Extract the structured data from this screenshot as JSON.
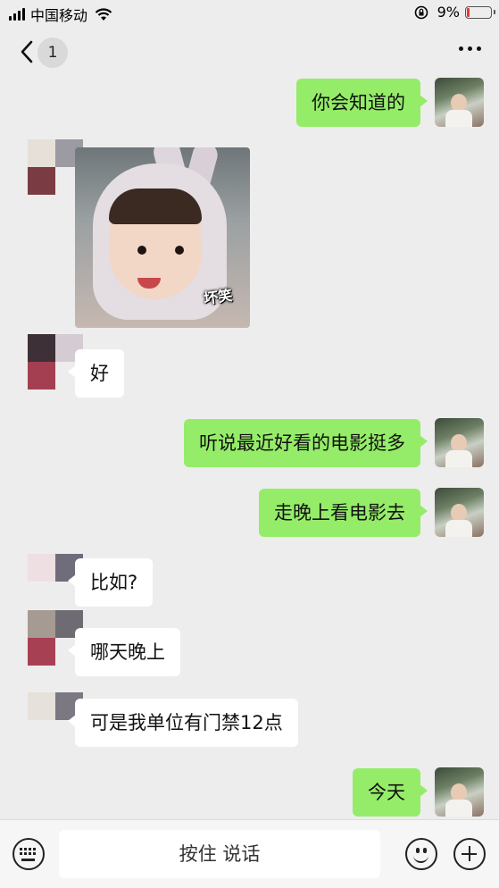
{
  "status_bar": {
    "carrier": "中国移动",
    "battery": "9%",
    "battery_level": 0.09,
    "battery_color": "#e53935"
  },
  "nav": {
    "unread_count": "1"
  },
  "sticker": {
    "caption": "坏笑"
  },
  "messages": [
    {
      "sender": "me",
      "text": "你会知道的"
    },
    {
      "sender": "other",
      "type": "sticker"
    },
    {
      "sender": "other",
      "text": "好"
    },
    {
      "sender": "me",
      "text": "听说最近好看的电影挺多"
    },
    {
      "sender": "me",
      "text": "走晚上看电影去"
    },
    {
      "sender": "other",
      "text": "比如?"
    },
    {
      "sender": "other",
      "text": "哪天晚上"
    },
    {
      "sender": "other",
      "text": "可是我单位有门禁12点"
    },
    {
      "sender": "me",
      "text": "今天"
    }
  ],
  "footer": {
    "voice_label": "按住 说话"
  },
  "colors": {
    "my_bubble": "#95ec69",
    "other_bubble": "#ffffff",
    "background": "#ededed"
  }
}
